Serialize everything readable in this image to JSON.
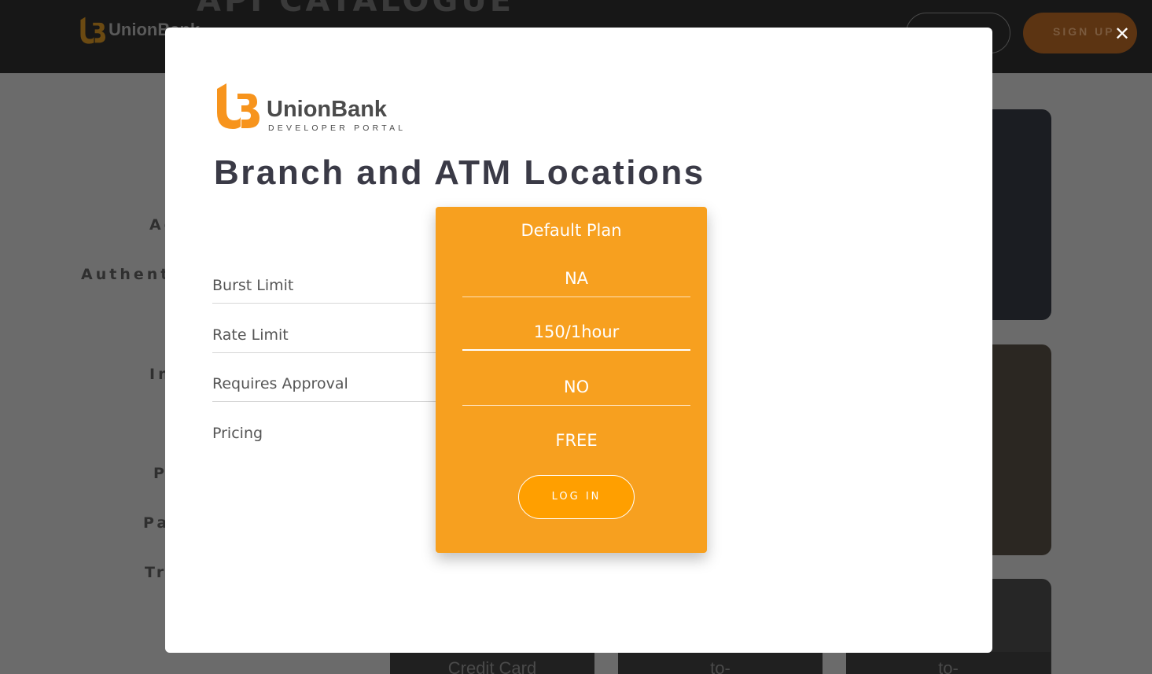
{
  "background": {
    "header": {
      "logo_text": "UnionBank",
      "big_title": "API CATALOGUE",
      "signup_label": "SIGN UP"
    },
    "sidebar_fragments": [
      "Ac",
      "Authenti",
      "In",
      "P",
      "Pa",
      "Tr"
    ],
    "tiles": [
      "Credit Card",
      "to-",
      "to-"
    ]
  },
  "modal": {
    "close_icon": "close-icon",
    "logo": {
      "name": "UnionBank",
      "subtitle": "DEVELOPER PORTAL"
    },
    "title": "Branch and ATM Locations",
    "attributes": [
      {
        "label": "Burst Limit"
      },
      {
        "label": "Rate Limit"
      },
      {
        "label": "Requires Approval"
      },
      {
        "label": "Pricing"
      }
    ],
    "plan": {
      "name": "Default Plan",
      "values": [
        "NA",
        "150/1hour",
        "NO",
        "FREE"
      ],
      "login_label": "LOG IN"
    }
  },
  "colors": {
    "accent": "#f7a01f",
    "login_button": "#ff9f00",
    "title_text": "#3a3a46"
  }
}
